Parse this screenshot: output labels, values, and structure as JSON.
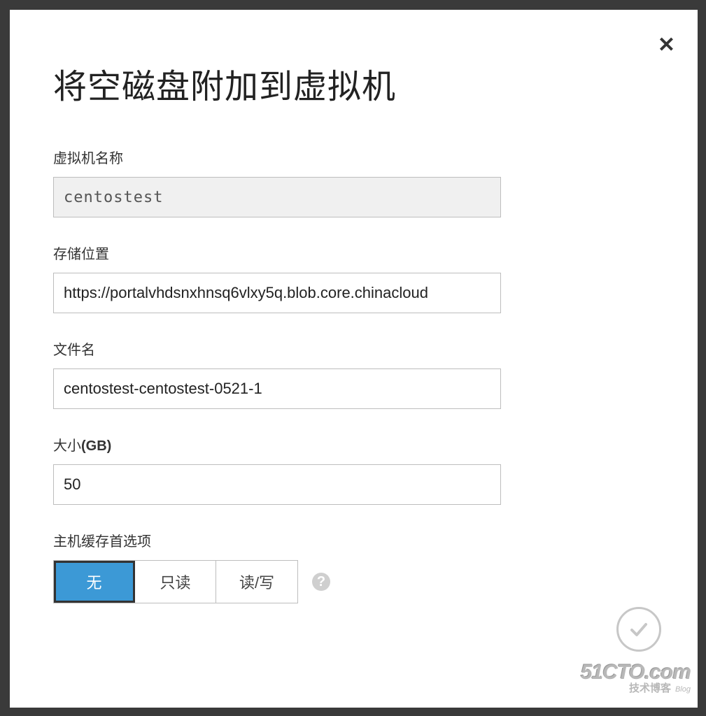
{
  "dialog": {
    "title": "将空磁盘附加到虚拟机",
    "close_symbol": "✕"
  },
  "fields": {
    "vm_name": {
      "label": "虚拟机名称",
      "value": "centostest"
    },
    "storage": {
      "label": "存储位置",
      "value": "https://portalvhdsnxhnsq6vlxy5q.blob.core.chinacloud"
    },
    "file_name": {
      "label": "文件名",
      "value": "centostest-centostest-0521-1"
    },
    "size": {
      "label_prefix": "大小",
      "label_unit": "(GB)",
      "value": "50"
    },
    "cache": {
      "label": "主机缓存首选项",
      "options": {
        "none": "无",
        "readonly": "只读",
        "readwrite": "读/写"
      },
      "selected": "none",
      "help_symbol": "?"
    }
  },
  "watermark": {
    "line1": "51CTO.com",
    "line2": "技术博客",
    "badge": "Blog"
  }
}
